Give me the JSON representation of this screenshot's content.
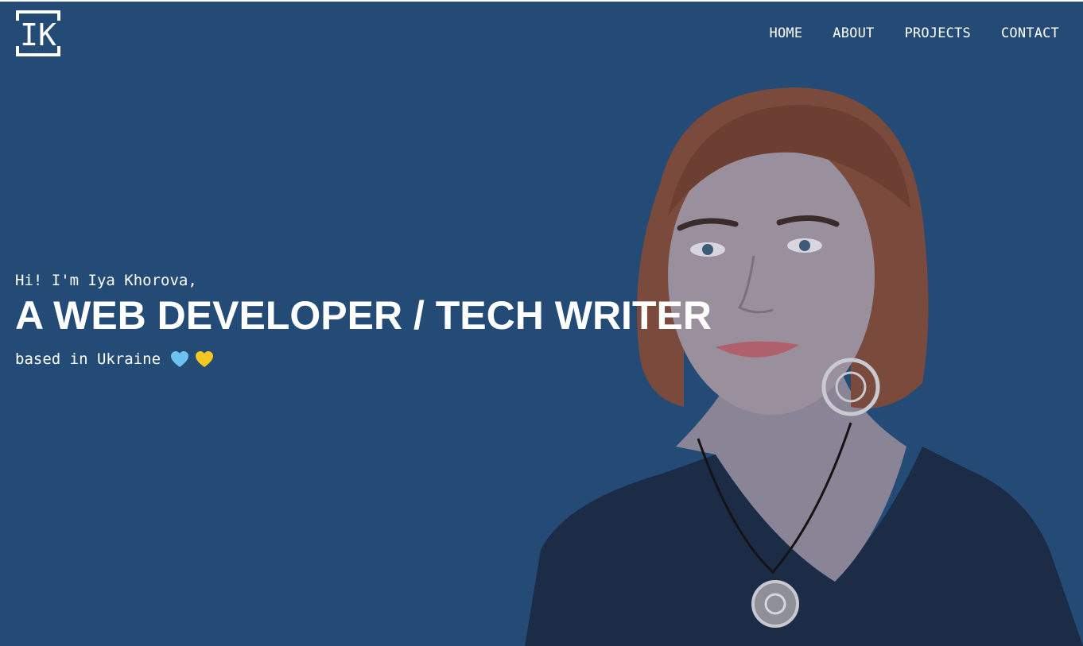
{
  "header": {
    "logo_text": "IK",
    "nav": [
      {
        "label": "HOME"
      },
      {
        "label": "ABOUT"
      },
      {
        "label": "PROJECTS"
      },
      {
        "label": "CONTACT"
      }
    ]
  },
  "hero": {
    "greeting": "Hi! I'm Iya Khorova,",
    "headline": "A WEB DEVELOPER / TECH WRITER",
    "location": "based in Ukraine",
    "icons": [
      "blue-heart-icon",
      "yellow-heart-icon"
    ]
  },
  "colors": {
    "background": "#234b75",
    "text": "#ffffff",
    "heart_blue": "#6cc3f0",
    "heart_yellow": "#f6c623"
  }
}
